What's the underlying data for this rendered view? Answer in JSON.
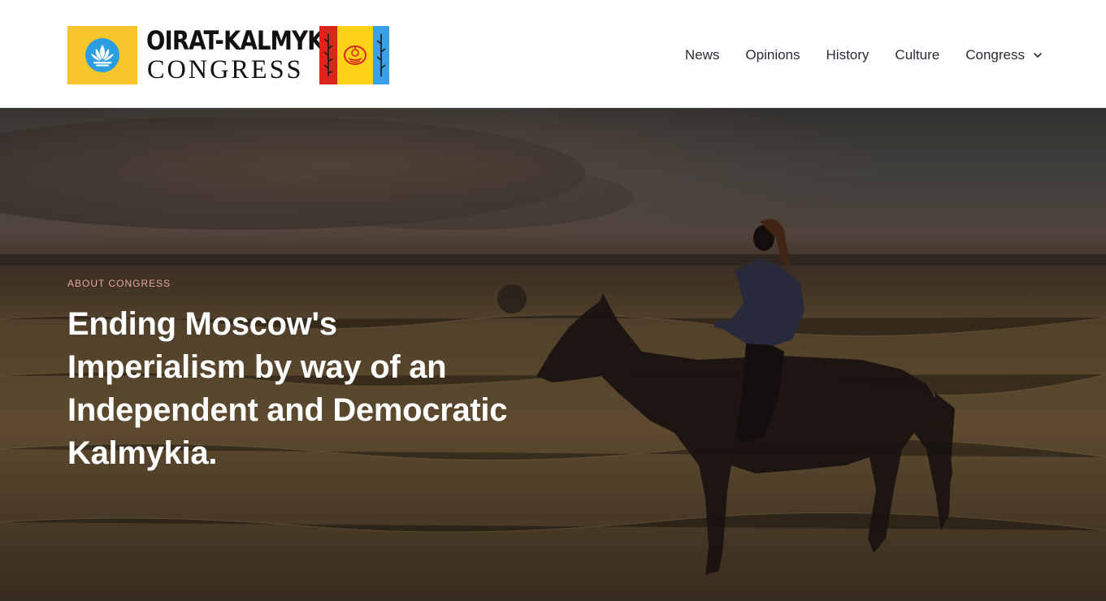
{
  "brand": {
    "name_top": "OIRAT-KALMYK",
    "name_bottom": "CONGRESS",
    "lotus_icon": "lotus-icon",
    "flag_icon": "kalmyk-flag-icon",
    "colors": {
      "lotus_bg": "#f7c62c",
      "lotus_circle": "#2a9ee0",
      "flag_red": "#d9251d",
      "flag_yellow": "#fcd116",
      "flag_blue": "#3aa0e8"
    }
  },
  "nav": {
    "items": [
      {
        "label": "News"
      },
      {
        "label": "Opinions"
      },
      {
        "label": "History"
      },
      {
        "label": "Culture"
      },
      {
        "label": "Congress",
        "icon": "chevron-down-icon"
      }
    ]
  },
  "hero": {
    "kicker": "ABOUT CONGRESS",
    "title": "Ending Moscow's Imperialism by way of an Independent and Democratic Kalmykia.",
    "kicker_color": "#e8a6a0"
  }
}
